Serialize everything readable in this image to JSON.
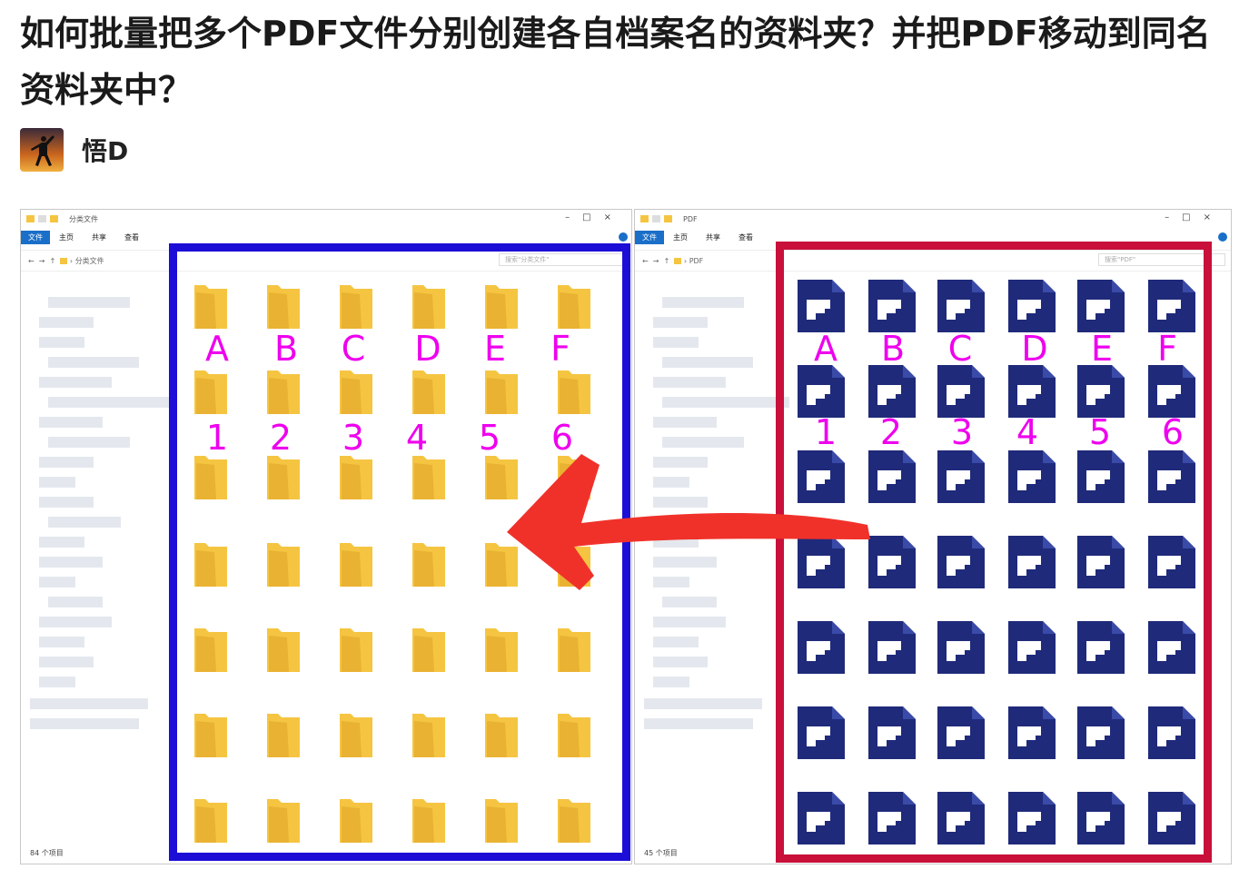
{
  "question": {
    "title": "如何批量把多个PDF文件分别创建各自档案名的资料夹？并把PDF移动到同名资料夹中？",
    "author": "悟D"
  },
  "left_window": {
    "title": "分类文件",
    "ribbon": [
      "文件",
      "主页",
      "共享",
      "查看"
    ],
    "breadcrumb": "分类文件",
    "search_placeholder": "搜索\"分类文件\"",
    "status": "84 个项目"
  },
  "right_window": {
    "title": "PDF",
    "ribbon": [
      "文件",
      "主页",
      "共享",
      "查看"
    ],
    "breadcrumb": "PDF",
    "search_placeholder": "搜索\"PDF\"",
    "status": "45 个项目"
  },
  "overlay": {
    "letters": [
      "A",
      "B",
      "C",
      "D",
      "E",
      "F"
    ],
    "numbers": [
      "1",
      "2",
      "3",
      "4",
      "5",
      "6"
    ],
    "letter_color": "#ee00ee",
    "left_box_color": "#1c0ed6",
    "right_box_color": "#c8103a",
    "arrow_color": "#f0312a"
  },
  "window_controls": [
    "–",
    "□",
    "×"
  ],
  "icons": {
    "folder": "folder-icon",
    "pdf": "pdf-file-icon"
  },
  "colors": {
    "folder": "#f5c542",
    "pdf": "#1f2a7a",
    "ribbon_file": "#1a6fc9"
  }
}
